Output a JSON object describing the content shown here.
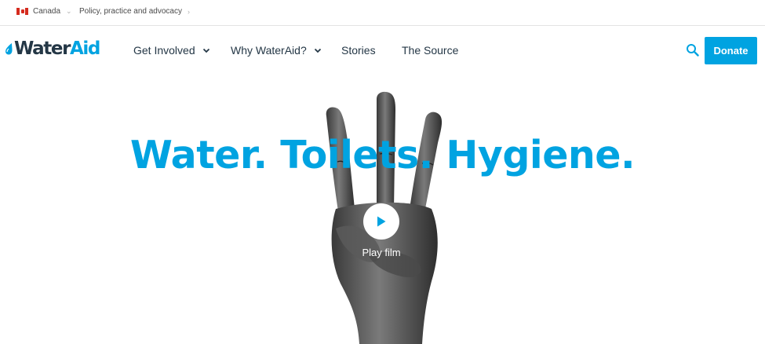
{
  "topbar": {
    "country_label": "Canada",
    "policy_label": "Policy, practice and advocacy"
  },
  "brand": {
    "logo_water": "Water",
    "logo_aid": "Aid"
  },
  "nav": {
    "items": [
      {
        "label": "Get Involved",
        "has_dropdown": true
      },
      {
        "label": "Why WaterAid?",
        "has_dropdown": true
      },
      {
        "label": "Stories",
        "has_dropdown": false
      },
      {
        "label": "The Source",
        "has_dropdown": false
      }
    ],
    "donate_label": "Donate"
  },
  "hero": {
    "headline": "Water. Toilets. Hygiene.",
    "play_label": "Play film"
  },
  "colors": {
    "brand_blue": "#00a3e1",
    "navy_text": "#243746",
    "flag_red": "#d52b1e"
  },
  "icons": {
    "flag": "canada-flag-icon",
    "dropdown": "chevron-down-icon",
    "breadcrumb": "chevron-right-icon",
    "search": "search-icon",
    "play": "play-icon"
  }
}
